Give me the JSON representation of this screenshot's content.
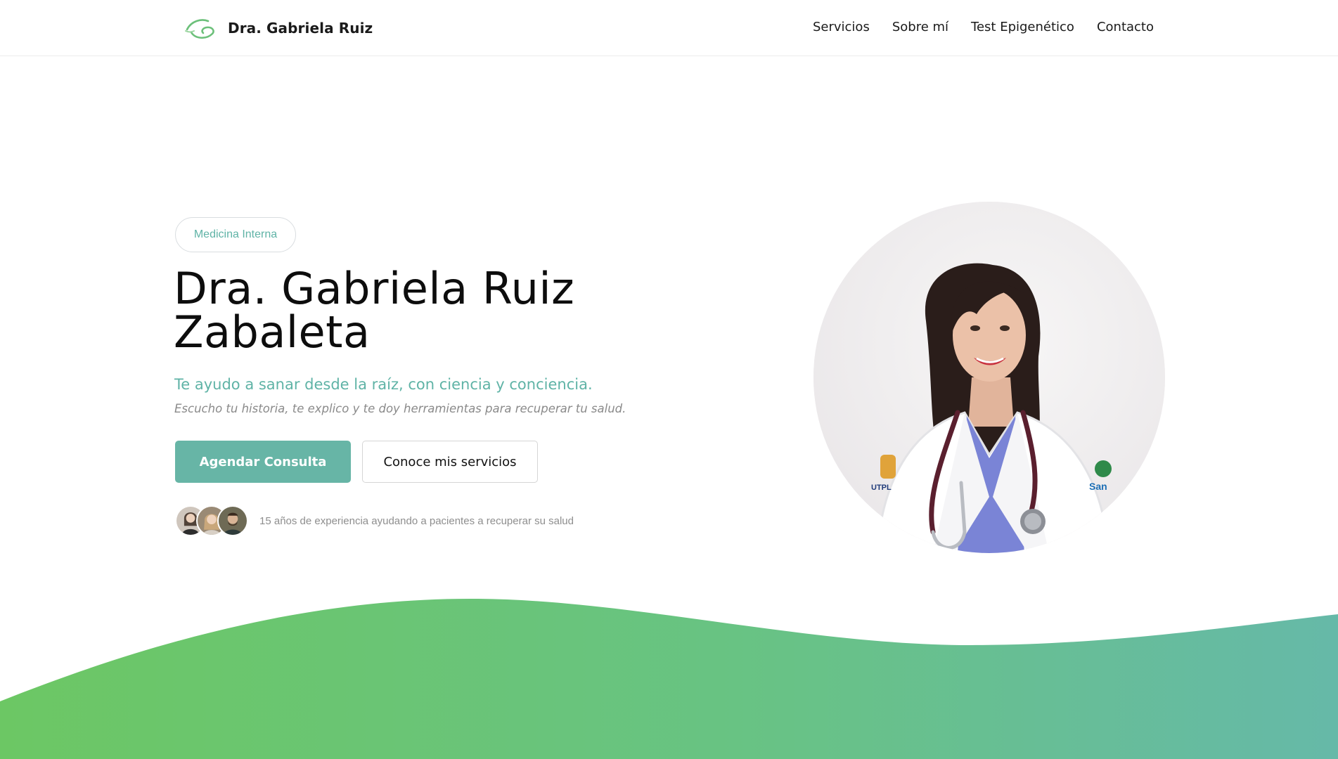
{
  "header": {
    "brand_name": "Dra. Gabriela Ruiz",
    "nav": [
      {
        "label": "Servicios"
      },
      {
        "label": "Sobre mí"
      },
      {
        "label": "Test Epigenético"
      },
      {
        "label": "Contacto"
      }
    ]
  },
  "hero": {
    "badge": "Medicina Interna",
    "title_line1": "Dra. Gabriela Ruiz",
    "title_line2": "Zabaleta",
    "subtitle": "Te ayudo a sanar desde la raíz, con ciencia y conciencia.",
    "tagline": "Escucho tu historia, te explico y te doy herramientas para recuperar tu salud.",
    "primary_button": "Agendar Consulta",
    "secondary_button": "Conoce mis servicios",
    "social_proof": "15 años de experiencia ayudando a pacientes a recuperar su salud"
  },
  "icons": {
    "logo": "leaf-wave-logo-icon"
  },
  "colors": {
    "accent": "#67b5a6",
    "accent_text": "#5fb3a6",
    "wave_start": "#6cc764",
    "wave_end": "#66b9a8"
  }
}
